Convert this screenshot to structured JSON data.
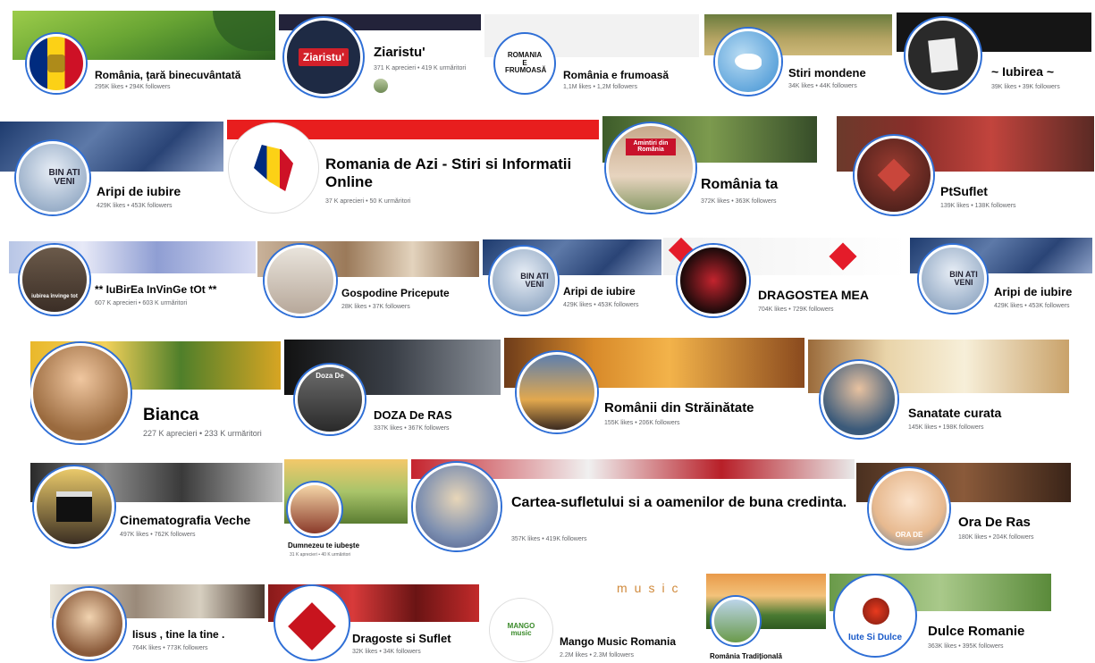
{
  "pages": [
    {
      "name": "România, țară binecuvântată",
      "stats": "295K likes • 294K followers"
    },
    {
      "name": "Ziaristu'",
      "stats": "371 K aprecieri • 419 K urmăritori",
      "avatar_text": "Ziaristu'"
    },
    {
      "name": "România e frumoasă",
      "stats": "1,1M likes • 1,2M followers",
      "avatar_text": "ROMANIA E FRUMOASĂ"
    },
    {
      "name": "Stiri mondene",
      "stats": "34K likes • 44K followers"
    },
    {
      "name": "~ Iubirea ~",
      "stats": "39K likes • 39K followers"
    },
    {
      "name": "Aripi de iubire",
      "stats": "429K likes • 453K followers",
      "avatar_text": "BIN ATI VENI"
    },
    {
      "name": "Romania de Azi - Stiri si Informatii Online",
      "stats": "37 K aprecieri • 50 K urmăritori"
    },
    {
      "name": "România ta",
      "stats": "372K likes • 363K followers",
      "avatar_text": "Amintiri din România"
    },
    {
      "name": "PtSuflet",
      "stats": "139K likes • 138K followers"
    },
    {
      "name": "** IuBirEa InVinGe tOt **",
      "stats": "607 K aprecieri • 603 K urmăritori",
      "avatar_text": "iubirea învinge tot"
    },
    {
      "name": "Gospodine Pricepute",
      "stats": "28K likes • 37K followers"
    },
    {
      "name": "Aripi de iubire",
      "stats": "429K likes • 453K followers",
      "avatar_text": "BIN ATI VENI"
    },
    {
      "name": "DRAGOSTEA MEA",
      "stats": "704K likes • 729K followers"
    },
    {
      "name": "Aripi de iubire",
      "stats": "429K likes • 453K followers",
      "avatar_text": "BIN ATI VENI"
    },
    {
      "name": "Bianca",
      "stats": "227 K aprecieri • 233 K urmăritori"
    },
    {
      "name": "DOZA De RAS",
      "stats": "337K likes • 367K followers",
      "avatar_text": "Doza De"
    },
    {
      "name": "Românii din Străinătate",
      "stats": "155K likes • 206K followers"
    },
    {
      "name": "Sanatate curata",
      "stats": "145K likes • 198K followers"
    },
    {
      "name": "Cinematografia Veche",
      "stats": "497K likes • 762K followers"
    },
    {
      "name": "Dumnezeu te iubește",
      "stats": "31 K aprecieri • 40 K urmăritori"
    },
    {
      "name": "Cartea-sufletului si a oamenilor de buna credinta.",
      "stats": "357K likes • 419K followers"
    },
    {
      "name": "Ora De Ras",
      "stats": "180K likes • 204K followers",
      "avatar_text": "ORA DE"
    },
    {
      "name": "Iisus , tine la tine .",
      "stats": "764K likes • 773K followers"
    },
    {
      "name": "Dragoste si Suflet",
      "stats": "32K likes • 34K followers"
    },
    {
      "name": "Mango Music Romania",
      "stats": "2.2M likes • 2.3M followers",
      "avatar_text": "MANGO music",
      "cover_text": "music"
    },
    {
      "name": "România Tradițională",
      "stats": ""
    },
    {
      "name": "Dulce Romanie",
      "stats": "363K likes • 395K followers",
      "avatar_text": "Iute Si Dulce"
    }
  ],
  "colors": {
    "name": "#050505",
    "stats": "#65676b",
    "avatar_ring": "#2f6fd6",
    "cover_red": "#e81e1e",
    "mango_music": "#d08a3c"
  },
  "icons": [
    "heart-icon",
    "dove-icon",
    "film-clapper-icon",
    "chili-pepper-icon",
    "flag-icon",
    "map-silhouette-icon"
  ]
}
